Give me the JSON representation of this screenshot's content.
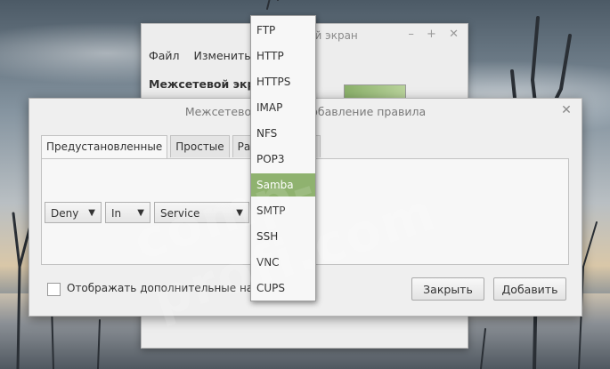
{
  "background_window": {
    "title": "Межсетевой экран",
    "controls": [
      "–",
      "+",
      "✕"
    ],
    "menu": [
      "Файл",
      "Изменить"
    ],
    "label": "Межсетевой экран"
  },
  "dialog": {
    "title": "Межсетевой экран: добавление правила",
    "close": "✕",
    "tabs": [
      "Предустановленные",
      "Простые",
      "Расширенные"
    ],
    "combos": {
      "policy": "Deny",
      "direction": "In",
      "category": "Service"
    },
    "checkbox_label": "Отображать дополнительные настройки",
    "close_button": "Закрыть",
    "add_button": "Добавить"
  },
  "dropdown": {
    "items": [
      "FTP",
      "HTTP",
      "HTTPS",
      "IMAP",
      "NFS",
      "POP3",
      "Samba",
      "SMTP",
      "SSH",
      "VNC",
      "CUPS"
    ],
    "selected": "Samba"
  },
  "colors": {
    "accent": "#8fb26f"
  },
  "watermark": "comp-profi.com"
}
